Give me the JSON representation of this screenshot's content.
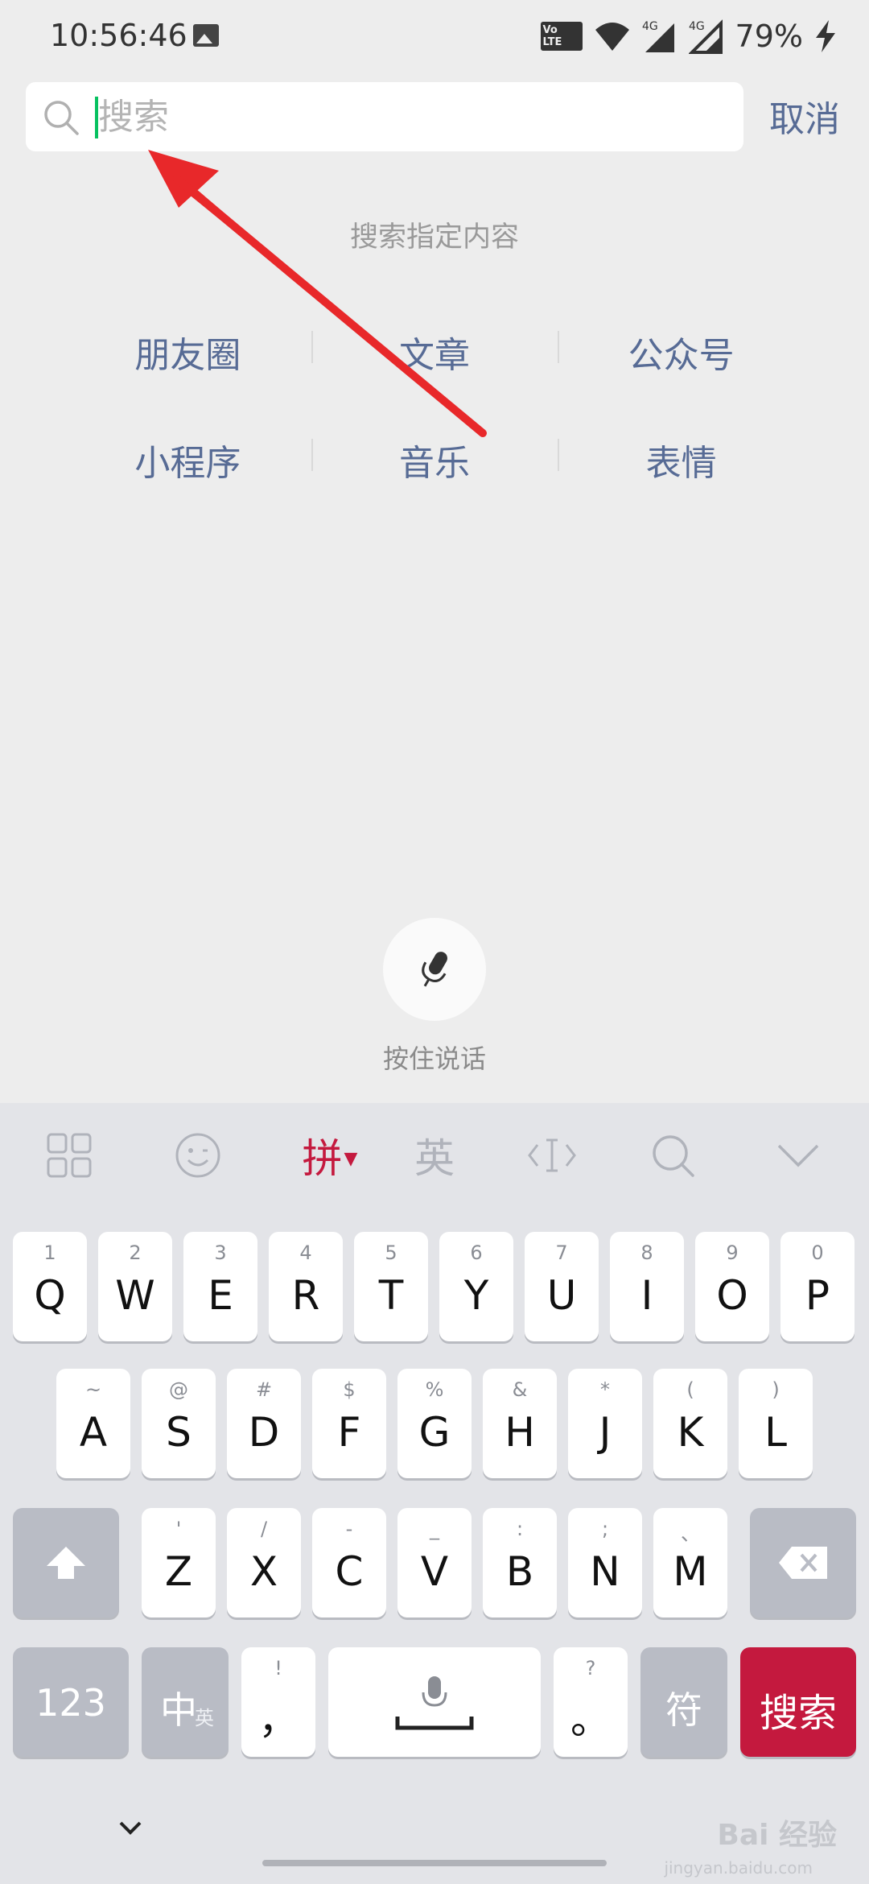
{
  "status_bar": {
    "time": "10:56:46",
    "network_badge": "Vo LTE",
    "network_labels": [
      "4G",
      "4G"
    ],
    "battery": "79%"
  },
  "search": {
    "placeholder": "搜索",
    "cancel_label": "取消",
    "hint": "搜索指定内容"
  },
  "categories": [
    [
      "朋友圈",
      "文章",
      "公众号"
    ],
    [
      "小程序",
      "音乐",
      "表情"
    ]
  ],
  "voice": {
    "label": "按住说话"
  },
  "keyboard": {
    "toolbar": {
      "pinyin_label": "拼",
      "english_label": "英"
    },
    "row1": [
      {
        "sub": "1",
        "main": "Q"
      },
      {
        "sub": "2",
        "main": "W"
      },
      {
        "sub": "3",
        "main": "E"
      },
      {
        "sub": "4",
        "main": "R"
      },
      {
        "sub": "5",
        "main": "T"
      },
      {
        "sub": "6",
        "main": "Y"
      },
      {
        "sub": "7",
        "main": "U"
      },
      {
        "sub": "8",
        "main": "I"
      },
      {
        "sub": "9",
        "main": "O"
      },
      {
        "sub": "0",
        "main": "P"
      }
    ],
    "row2": [
      {
        "sub": "~",
        "main": "A"
      },
      {
        "sub": "@",
        "main": "S"
      },
      {
        "sub": "#",
        "main": "D"
      },
      {
        "sub": "$",
        "main": "F"
      },
      {
        "sub": "%",
        "main": "G"
      },
      {
        "sub": "&",
        "main": "H"
      },
      {
        "sub": "*",
        "main": "J"
      },
      {
        "sub": "(",
        "main": "K"
      },
      {
        "sub": ")",
        "main": "L"
      }
    ],
    "row3": [
      {
        "sub": "'",
        "main": "Z"
      },
      {
        "sub": "/",
        "main": "X"
      },
      {
        "sub": "-",
        "main": "C"
      },
      {
        "sub": "_",
        "main": "V"
      },
      {
        "sub": ":",
        "main": "B"
      },
      {
        "sub": ";",
        "main": "N"
      },
      {
        "sub": "、",
        "main": "M"
      }
    ],
    "row4": {
      "num_label": "123",
      "lang_label": "中",
      "lang_sub": "英",
      "comma_sub": "!",
      "comma_main": "，",
      "period_sub": "?",
      "period_main": "。",
      "symbol_label": "符",
      "search_label": "搜索"
    }
  },
  "watermark": {
    "text": "Bai 经验",
    "sub": "jingyan.baidu.com"
  },
  "colors": {
    "accent_link": "#576b95",
    "cursor": "#07c160",
    "keyboard_accent": "#c4193e",
    "annotation": "#e8282a"
  }
}
